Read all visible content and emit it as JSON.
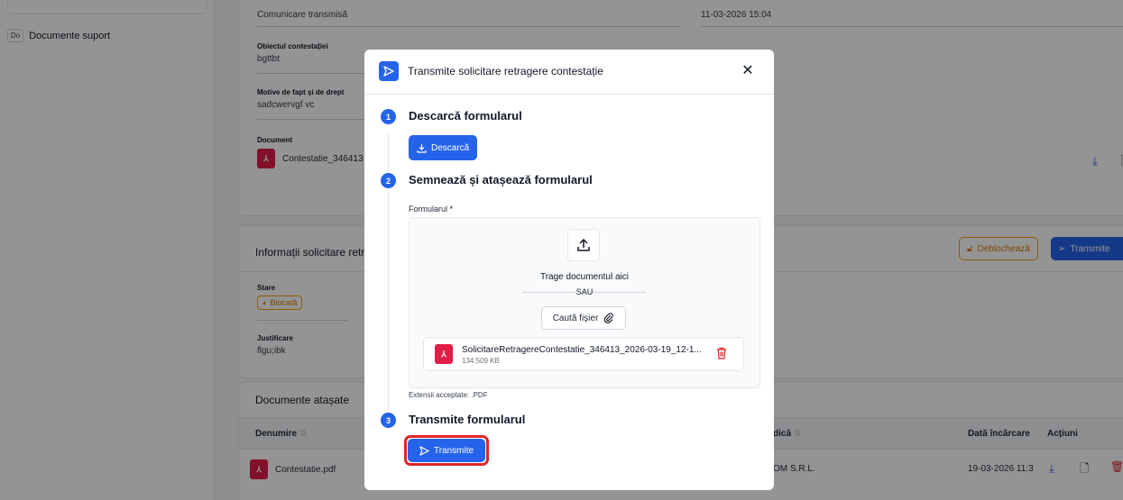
{
  "sidebar": {
    "items": [
      {
        "abbr": "Do",
        "label": "Documente suport"
      }
    ]
  },
  "background": {
    "card1": {
      "comm_value": "Comunicare transmisă",
      "comm_date": "11-03-2026 15:04",
      "objective_label": "Obiectul contestației",
      "objective_value": "bgttbt",
      "motives_label": "Motive de fapt și de drept",
      "motives_value": "sadcwervgf vc",
      "document_label": "Document",
      "document_name": "Contestatie_346413"
    },
    "card2": {
      "title": "Informații solicitare retra",
      "unlock_label": "Deblochează",
      "send_label": "Transmite",
      "status_label": "Stare",
      "status_value": "Blocată",
      "justification_label": "Justificare",
      "justification_value": "flgu;ibk"
    },
    "card3": {
      "title": "Documente atașate",
      "columns": [
        "Denumire",
        "dică",
        "Dată încărcare",
        "Acțiuni"
      ],
      "row": {
        "name": "Contestatie.pdf",
        "entity": "OM S.R.L.",
        "date": "19-03-2026 11:3"
      }
    }
  },
  "modal": {
    "title": "Transmite solicitare retragere contestație",
    "steps": [
      {
        "num": "1",
        "title": "Descarcă formularul",
        "button": "Descarcă"
      },
      {
        "num": "2",
        "title": "Semnează și atașează formularul"
      },
      {
        "num": "3",
        "title": "Transmite formularul",
        "button": "Transmite"
      }
    ],
    "form_label": "Formularul",
    "required_mark": "*",
    "dropzone": {
      "drag_text": "Trage documentul aici",
      "or_text": "SAU",
      "browse_label": "Caută fișier"
    },
    "file": {
      "name": "SolicitareRetragereContestatie_346413_2026-03-19_12-1...",
      "size": "134.509 KB"
    },
    "extensions_text": "Extensii acceptate: .PDF"
  },
  "colors": {
    "accent": "#2563eb",
    "danger": "#dc2626",
    "pdf": "#e11d48",
    "amber": "#f59e0b"
  }
}
